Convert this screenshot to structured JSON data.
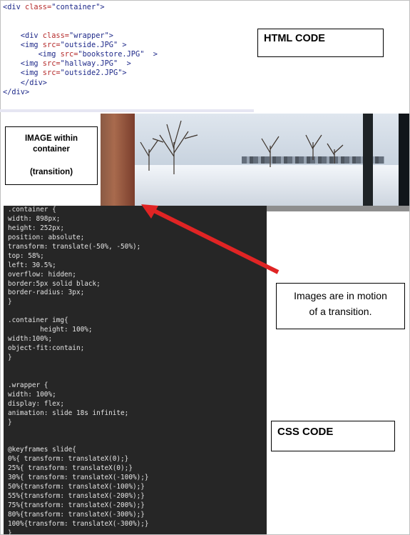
{
  "html_code_lines": [
    [
      {
        "t": "tag",
        "s": "<div "
      },
      {
        "t": "attr",
        "s": "class="
      },
      {
        "t": "val",
        "s": "\"container\">"
      }
    ],
    [],
    [],
    [
      {
        "t": "tag",
        "s": "    <div "
      },
      {
        "t": "attr",
        "s": "class="
      },
      {
        "t": "val",
        "s": "\"wrapper\">"
      }
    ],
    [
      {
        "t": "tag",
        "s": "    <img "
      },
      {
        "t": "attr",
        "s": "src="
      },
      {
        "t": "val",
        "s": "\"outside.JPG\" >"
      }
    ],
    [
      {
        "t": "tag",
        "s": "        <img "
      },
      {
        "t": "attr",
        "s": "src="
      },
      {
        "t": "val",
        "s": "\"bookstore.JPG\"  >"
      }
    ],
    [
      {
        "t": "tag",
        "s": "    <img "
      },
      {
        "t": "attr",
        "s": "src="
      },
      {
        "t": "val",
        "s": "\"hallway.JPG\"  >"
      }
    ],
    [
      {
        "t": "tag",
        "s": "    <img "
      },
      {
        "t": "attr",
        "s": "src="
      },
      {
        "t": "val",
        "s": "\"outside2.JPG\">"
      }
    ],
    [
      {
        "t": "tag",
        "s": "    </div>"
      }
    ],
    [
      {
        "t": "tag",
        "s": "</div>"
      }
    ]
  ],
  "labels": {
    "html_code": "HTML CODE",
    "image_line1": "IMAGE within",
    "image_line2": "container",
    "image_line3": "(transition)",
    "motion_line1": "Images are in motion",
    "motion_line2": "of a transition.",
    "css_code": "CSS CODE"
  },
  "css_code_lines": [
    ".container {",
    "width: 898px;",
    "height: 252px;",
    "position: absolute;",
    "transform: translate(-50%, -50%);",
    "top: 58%;",
    "left: 30.5%;",
    "overflow: hidden;",
    "border:5px solid black;",
    "border-radius: 3px;",
    "}",
    "",
    ".container img{",
    "        height: 100%;",
    "width:100%;",
    "object-fit:contain;",
    "}",
    "",
    "",
    ".wrapper {",
    "width: 100%;",
    "display: flex;",
    "animation: slide 18s infinite;",
    "}",
    "",
    "",
    "@keyframes slide{",
    "0%{ transform: translateX(0);}",
    "25%{ transform: translateX(0);}",
    "30%{ transform: translateX(-100%);}",
    "50%{transform: translateX(-100%);}",
    "55%{transform: translateX(-200%);}",
    "75%{transform: translateX(-200%);}",
    "80%{transform: translateX(-300%);}",
    "100%{transform: translateX(-300%);}",
    "}"
  ],
  "colors": {
    "arrow": "#e02424",
    "code_tag": "#1f2a8a",
    "code_attr": "#b52a2a",
    "css_bg": "#262626"
  }
}
